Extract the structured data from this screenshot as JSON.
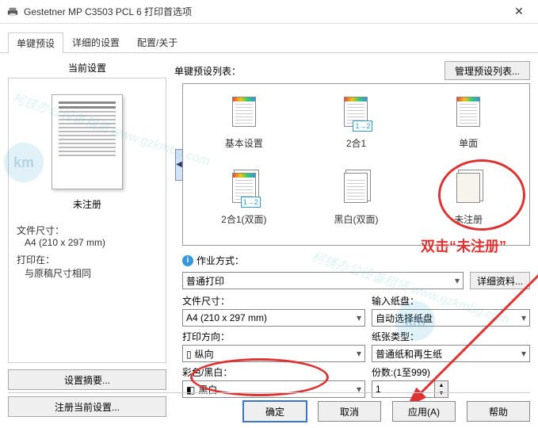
{
  "window": {
    "title": "Gestetner MP C3503 PCL 6 打印首选项"
  },
  "tabs": [
    "单键预设",
    "详细的设置",
    "配置/关于"
  ],
  "left": {
    "title": "当前设置",
    "unregistered": "未注册",
    "doc_size_label": "文件尺寸：",
    "doc_size_value": "A4 (210 x 297 mm)",
    "print_on_label": "打印在：",
    "print_on_value": "与原稿尺寸相同",
    "summary_btn": "设置摘要...",
    "register_btn": "注册当前设置..."
  },
  "presets": {
    "list_label": "单键预设列表：",
    "manage_btn": "管理预设列表...",
    "items": [
      {
        "label": "基本设置"
      },
      {
        "label": "2合1"
      },
      {
        "label": "单面"
      },
      {
        "label": "2合1(双面)"
      },
      {
        "label": "黑白(双面)"
      },
      {
        "label": "未注册"
      }
    ]
  },
  "annotation": "双击“未注册”",
  "form": {
    "job_type_label": "作业方式：",
    "job_type_value": "普通打印",
    "detail_btn": "详细资料...",
    "doc_size_label": "文件尺寸：",
    "doc_size_value": "A4 (210 x 297 mm)",
    "orient_label": "打印方向：",
    "orient_value": "纵向",
    "color_label": "彩色/黑白：",
    "color_value": "黑白",
    "tray_label": "输入纸盘：",
    "tray_value": "自动选择纸盘",
    "paper_label": "纸张类型：",
    "paper_value": "普通纸和再生纸",
    "copies_label": "份数:(1至999)",
    "copies_value": "1"
  },
  "buttons": {
    "ok": "确定",
    "cancel": "取消",
    "apply": "应用(A)",
    "help": "帮助"
  },
  "watermark": "柯镁办公设备租赁 www.gzkmbg.com"
}
